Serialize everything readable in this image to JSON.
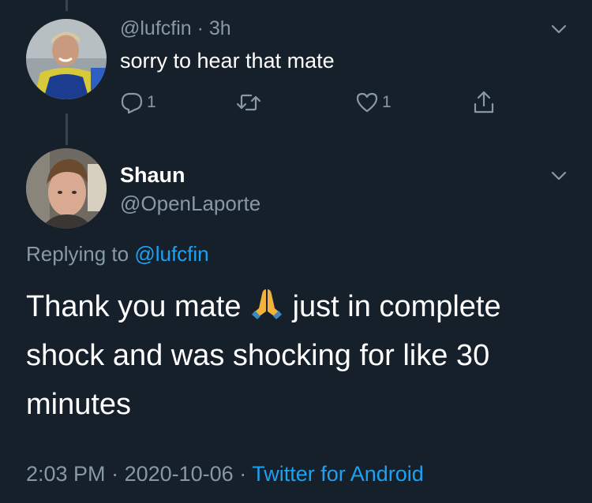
{
  "reply_tweet": {
    "handle": "@lufcfin",
    "separator": " · ",
    "time": "3h",
    "text": "sorry to hear that mate",
    "reply_count": "1",
    "like_count": "1"
  },
  "main_tweet": {
    "name": "Shaun",
    "handle": "@OpenLaporte",
    "replying_prefix": "Replying to ",
    "replying_mention": "@lufcfin",
    "text_before_emoji": "Thank you mate ",
    "emoji": "folded-hands-emoji",
    "text_after_emoji": " just in complete shock and was shocking for like 30 minutes",
    "time": "2:03 PM",
    "dot1": " · ",
    "date": "2020-10-06",
    "dot2": " · ",
    "source": "Twitter for Android"
  },
  "colors": {
    "background": "#15202b",
    "secondary_text": "#8899a6",
    "link": "#1da1f2",
    "thread_line": "#38444d"
  }
}
